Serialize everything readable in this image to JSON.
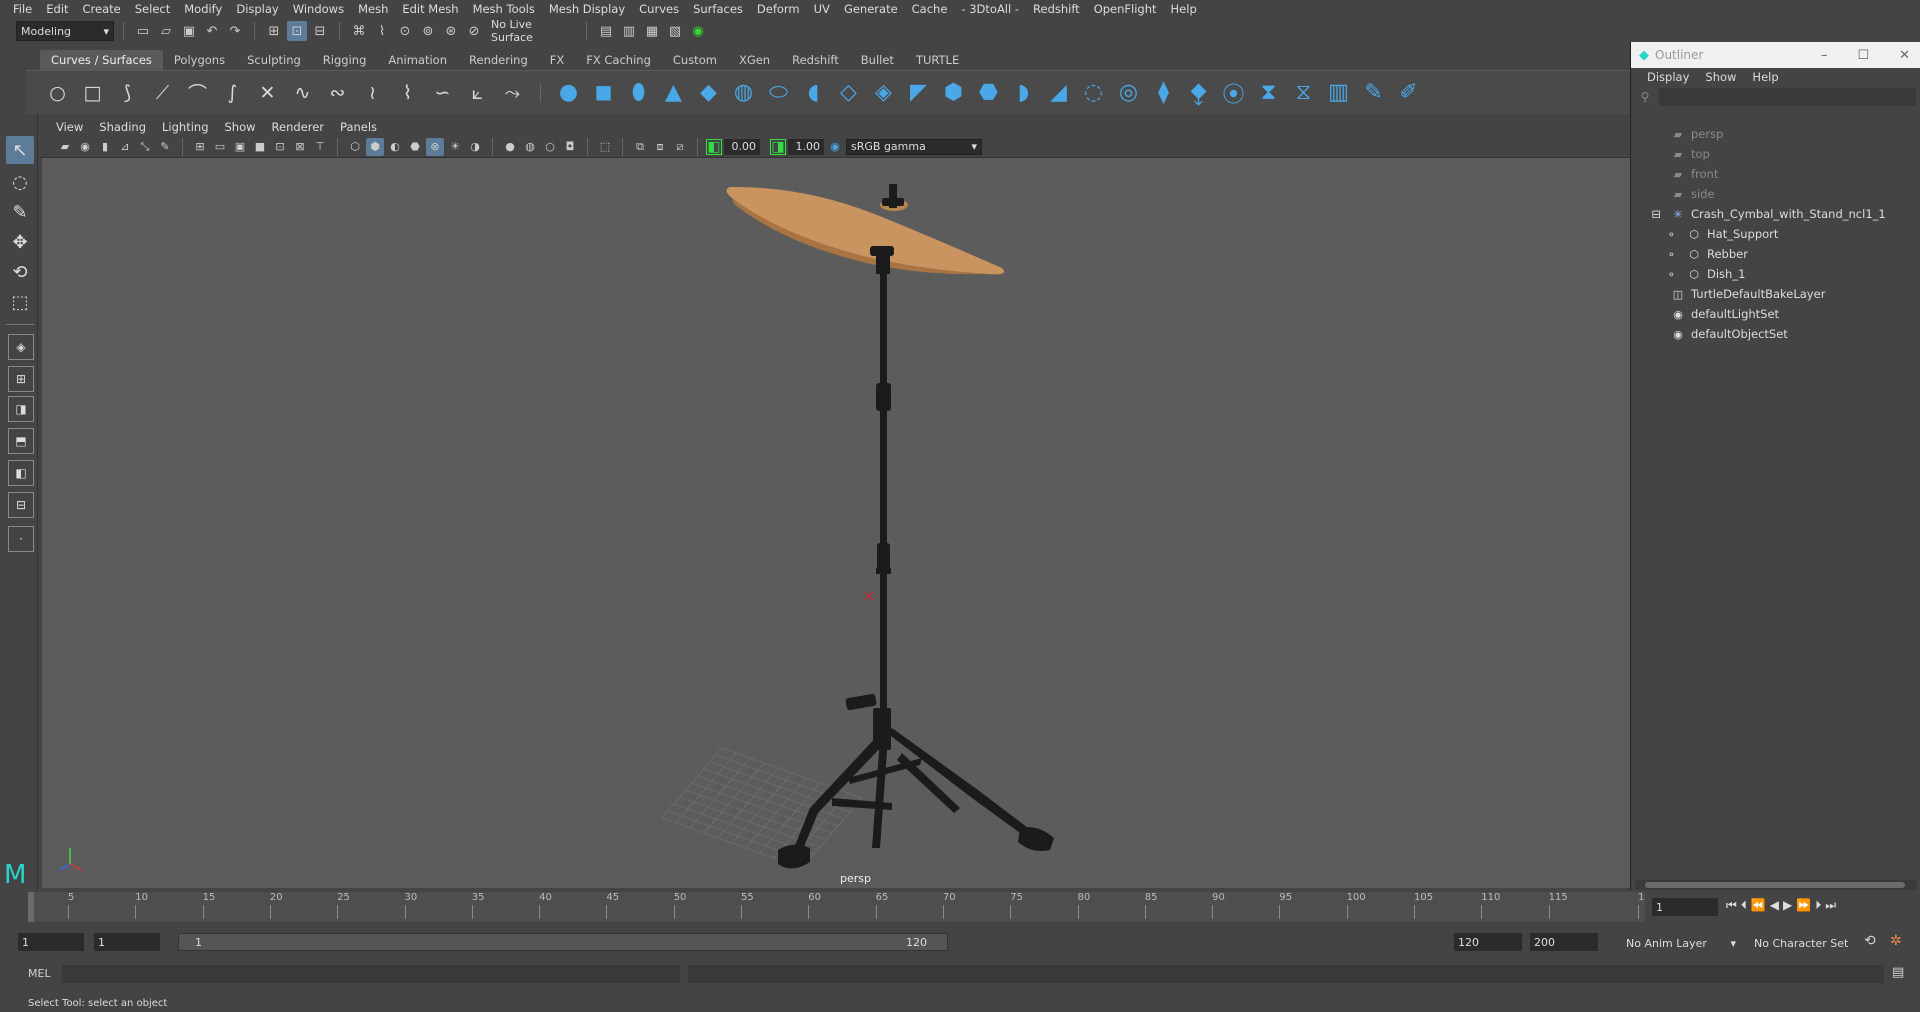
{
  "menus": [
    "File",
    "Edit",
    "Create",
    "Select",
    "Modify",
    "Display",
    "Windows",
    "Mesh",
    "Edit Mesh",
    "Mesh Tools",
    "Mesh Display",
    "Curves",
    "Surfaces",
    "Deform",
    "UV",
    "Generate",
    "Cache",
    "- 3DtoAll -",
    "Redshift",
    "OpenFlight",
    "Help"
  ],
  "status": {
    "mode": "Modeling",
    "live_surface": "No Live Surface"
  },
  "shelf_tabs": [
    "Curves / Surfaces",
    "Polygons",
    "Sculpting",
    "Rigging",
    "Animation",
    "Rendering",
    "FX",
    "FX Caching",
    "Custom",
    "XGen",
    "Redshift",
    "Bullet",
    "TURTLE"
  ],
  "panel_menu": [
    "View",
    "Shading",
    "Lighting",
    "Show",
    "Renderer",
    "Panels"
  ],
  "panel_tools": {
    "exposure": "0.00",
    "gamma": "1.00",
    "colorspace": "sRGB gamma"
  },
  "viewport": {
    "camera_label": "persp"
  },
  "outliner": {
    "title": "Outliner",
    "menu": [
      "Display",
      "Show",
      "Help"
    ],
    "items": [
      {
        "label": "persp",
        "icon": "camera-icon",
        "indent": 1,
        "dim": true
      },
      {
        "label": "top",
        "icon": "camera-icon",
        "indent": 1,
        "dim": true
      },
      {
        "label": "front",
        "icon": "camera-icon",
        "indent": 1,
        "dim": true
      },
      {
        "label": "side",
        "icon": "camera-icon",
        "indent": 1,
        "dim": true
      },
      {
        "label": "Crash_Cymbal_with_Stand_ncl1_1",
        "icon": "group-icon",
        "indent": 1,
        "expanded": true
      },
      {
        "label": "Hat_Support",
        "icon": "mesh-icon",
        "indent": 2
      },
      {
        "label": "Rebber",
        "icon": "mesh-icon",
        "indent": 2
      },
      {
        "label": "Dish_1",
        "icon": "mesh-icon",
        "indent": 2
      },
      {
        "label": "TurtleDefaultBakeLayer",
        "icon": "layer-icon",
        "indent": 1
      },
      {
        "label": "defaultLightSet",
        "icon": "set-icon",
        "indent": 1
      },
      {
        "label": "defaultObjectSet",
        "icon": "set-icon",
        "indent": 1
      }
    ]
  },
  "timeline": {
    "ticks": [
      "1",
      "5",
      "10",
      "15",
      "20",
      "25",
      "30",
      "35",
      "40",
      "45",
      "50",
      "55",
      "60",
      "65",
      "70",
      "75",
      "80",
      "85",
      "90",
      "95",
      "100",
      "105",
      "110",
      "115",
      "1"
    ],
    "current_frame": "1"
  },
  "range": {
    "start": "1",
    "playback_start": "1",
    "bar_start": "1",
    "bar_end": "120",
    "playback_end": "120",
    "end": "200",
    "anim_layer": "No Anim Layer",
    "character_set": "No Character Set"
  },
  "cmdline": {
    "label": "MEL"
  },
  "help_text": "Select Tool: select an object",
  "colors": {
    "accent": "#5d7c99",
    "shelf_blue": "#4aa8e8",
    "cymbal": "#c9945f",
    "viewport": "#5c5c5c"
  }
}
